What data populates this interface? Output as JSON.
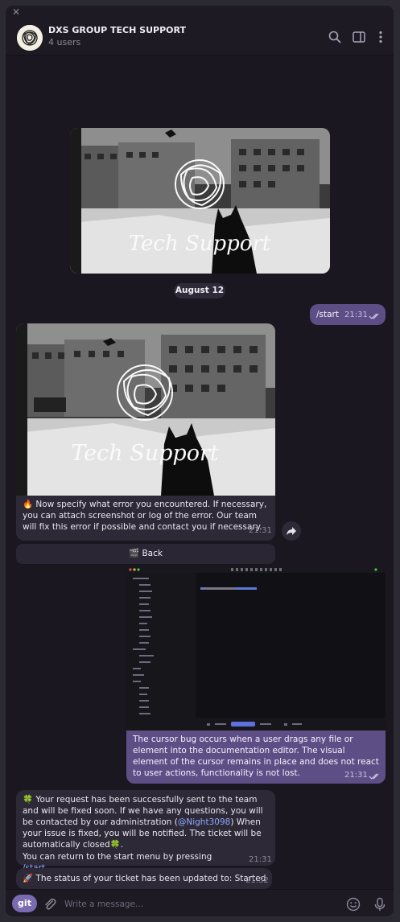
{
  "window": {
    "close_glyph": "✕"
  },
  "header": {
    "title": "DXS GROUP TECH SUPPORT",
    "subtitle": "4 users",
    "icons": [
      "search-icon",
      "sidebar-toggle-icon",
      "more-vertical-icon"
    ]
  },
  "banner": {
    "caption": "Tech Support"
  },
  "date_separator": "August 12",
  "messages": {
    "start": {
      "text": "/start",
      "time": "21:31"
    },
    "specify_error": {
      "emoji": "🔥",
      "text": "Now specify what error you encountered. If necessary, you can attach screenshot or log of the error. Our team will fix this error if possible and contact you if necessary.",
      "time": "21:31",
      "button_icon": "🎬",
      "button_label": "Back"
    },
    "cursor_bug": {
      "text": "The cursor bug occurs when a user drags any file or element into the documentation editor. The visual element of the cursor remains in place and does not react to user actions, functionality is not lost.",
      "time": "21:31"
    },
    "request_sent": {
      "emoji": "🍀",
      "text_before_mention": "Your request has been successfully sent to the team and will be fixed soon. If we have any questions, you will be contacted by our administration (",
      "mention": "@Night3098",
      "text_after_mention": ") When your issue is fixed, you will be notified. The ticket will be automatically closed",
      "emoji_end": "🍀",
      "suffix": ".",
      "start_menu_text": "You can return to the start menu by pressing ",
      "start_command": "/start",
      "time": "21:31"
    },
    "status": {
      "emoji": "🚀",
      "text": "The status of your ticket has been updated to: Started",
      "time": "21:32"
    }
  },
  "composer": {
    "git_label": "git",
    "placeholder": "Write a message...",
    "icons": [
      "attach-icon",
      "emoji-icon",
      "microphone-icon"
    ]
  },
  "colors": {
    "background": "#19161f",
    "outgoing_bubble": "#5d4f86",
    "incoming_bubble": "#2d2937",
    "accent": "#7a6bb0",
    "link": "#8fa9ff"
  }
}
